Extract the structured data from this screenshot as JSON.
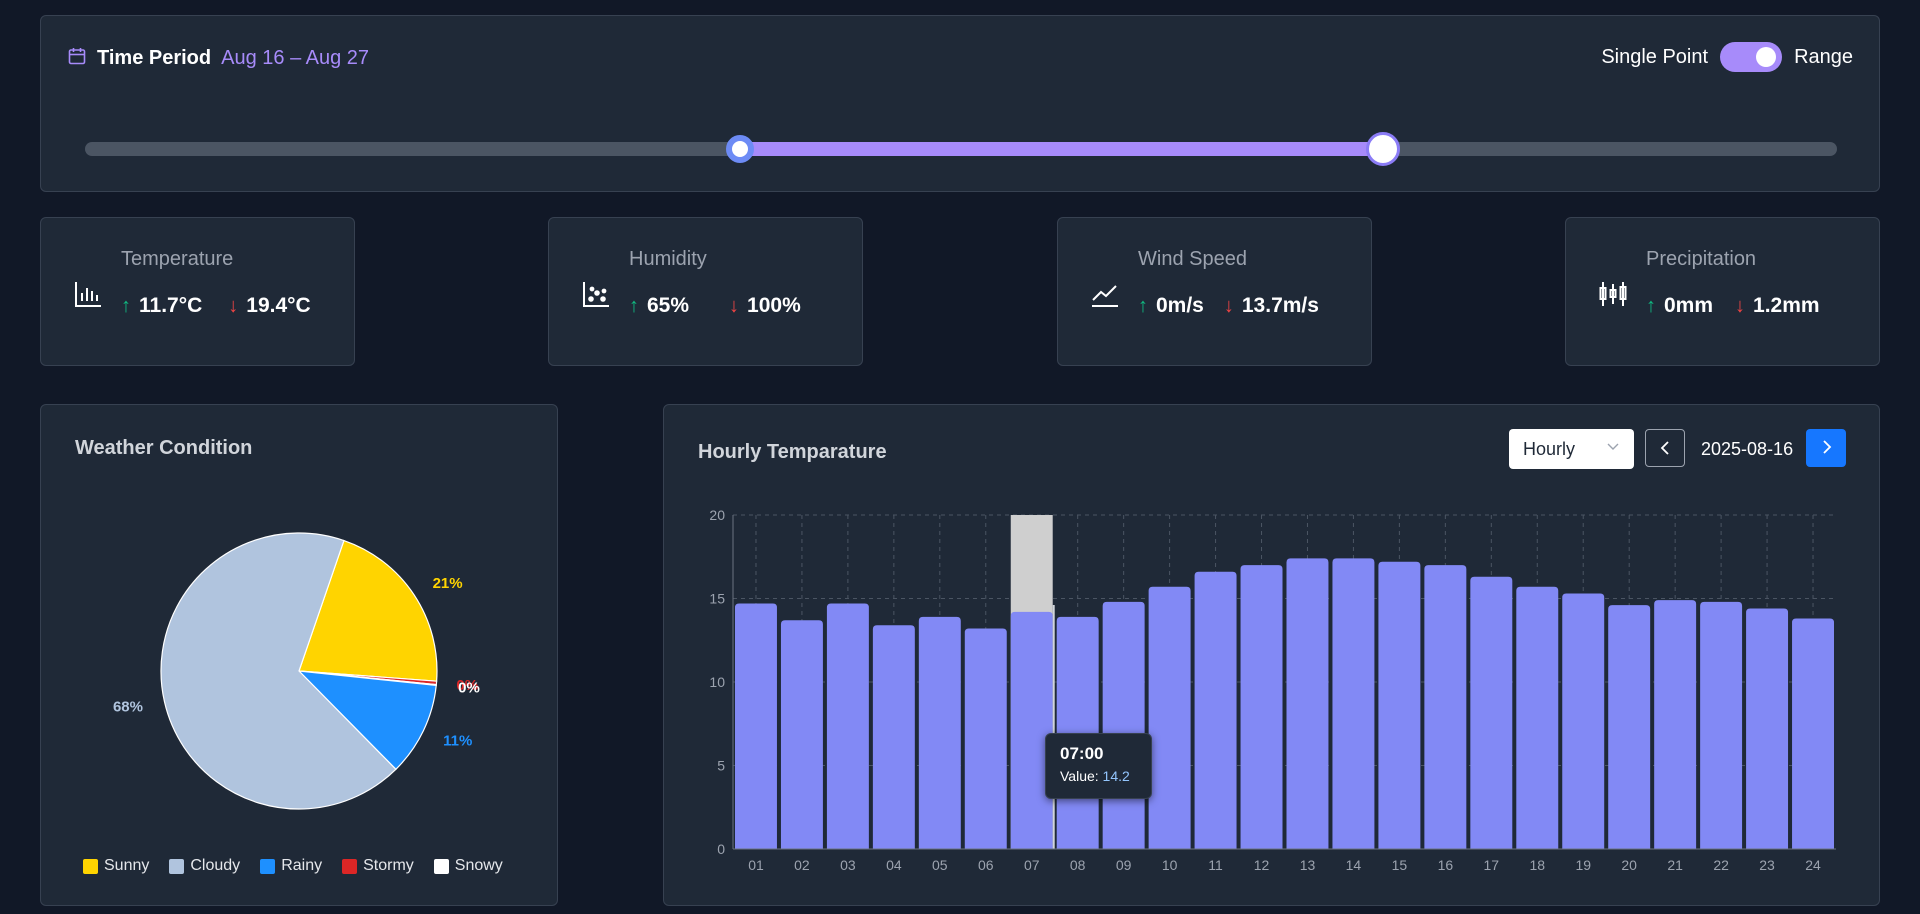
{
  "time_period": {
    "label": "Time Period",
    "range": "Aug 16 – Aug 27",
    "toggle_left": "Single Point",
    "toggle_right": "Range",
    "toggle_on": true,
    "slider_start_fraction": 0.374,
    "slider_end_fraction": 0.741
  },
  "metrics": [
    {
      "title": "Temperature",
      "icon": "bar-chart-icon",
      "high": "11.7°C",
      "low": "19.4°C"
    },
    {
      "title": "Humidity",
      "icon": "scatter-chart-icon",
      "high": "65%",
      "low": "100%"
    },
    {
      "title": "Wind Speed",
      "icon": "line-chart-icon",
      "high": "0m/s",
      "low": "13.7m/s"
    },
    {
      "title": "Precipitation",
      "icon": "candlestick-icon",
      "high": "0mm",
      "low": "1.2mm"
    }
  ],
  "weather_condition": {
    "title": "Weather Condition",
    "legend": [
      "Sunny",
      "Cloudy",
      "Rainy",
      "Stormy",
      "Snowy"
    ]
  },
  "hourly": {
    "title": "Hourly Temparature",
    "granularity": "Hourly",
    "date": "2025-08-16",
    "tooltip_time": "07:00",
    "tooltip_label": "Value: ",
    "tooltip_value": "14.2"
  },
  "colors": {
    "accent": "#a78bfa",
    "bar": "#8289f5",
    "up": "#10b981",
    "down": "#ef4444",
    "primary_button": "#1677ff"
  },
  "chart_data": [
    {
      "type": "pie",
      "title": "Weather Condition",
      "categories": [
        "Sunny",
        "Cloudy",
        "Rainy",
        "Stormy",
        "Snowy"
      ],
      "values": [
        21,
        68,
        11,
        0.4,
        0.1
      ],
      "labels": [
        "21%",
        "68%",
        "11%",
        "0%",
        "0%"
      ],
      "colors": [
        "#ffd400",
        "#b0c4de",
        "#1e90ff",
        "#dc2626",
        "#ffffff"
      ],
      "legend": "bottom"
    },
    {
      "type": "bar",
      "title": "Hourly Temparature",
      "categories": [
        "01",
        "02",
        "03",
        "04",
        "05",
        "06",
        "07",
        "08",
        "09",
        "10",
        "11",
        "12",
        "13",
        "14",
        "15",
        "16",
        "17",
        "18",
        "19",
        "20",
        "21",
        "22",
        "23",
        "24"
      ],
      "values": [
        14.7,
        13.7,
        14.7,
        13.4,
        13.9,
        13.2,
        14.2,
        13.9,
        14.8,
        15.7,
        16.6,
        17.0,
        17.4,
        17.4,
        17.2,
        17.0,
        16.3,
        15.7,
        15.3,
        14.6,
        14.9,
        14.8,
        14.4,
        13.8
      ],
      "ylim": [
        0,
        20
      ],
      "yticks": [
        0,
        5,
        10,
        15,
        20
      ],
      "grid": true,
      "highlight_category": "07"
    }
  ]
}
